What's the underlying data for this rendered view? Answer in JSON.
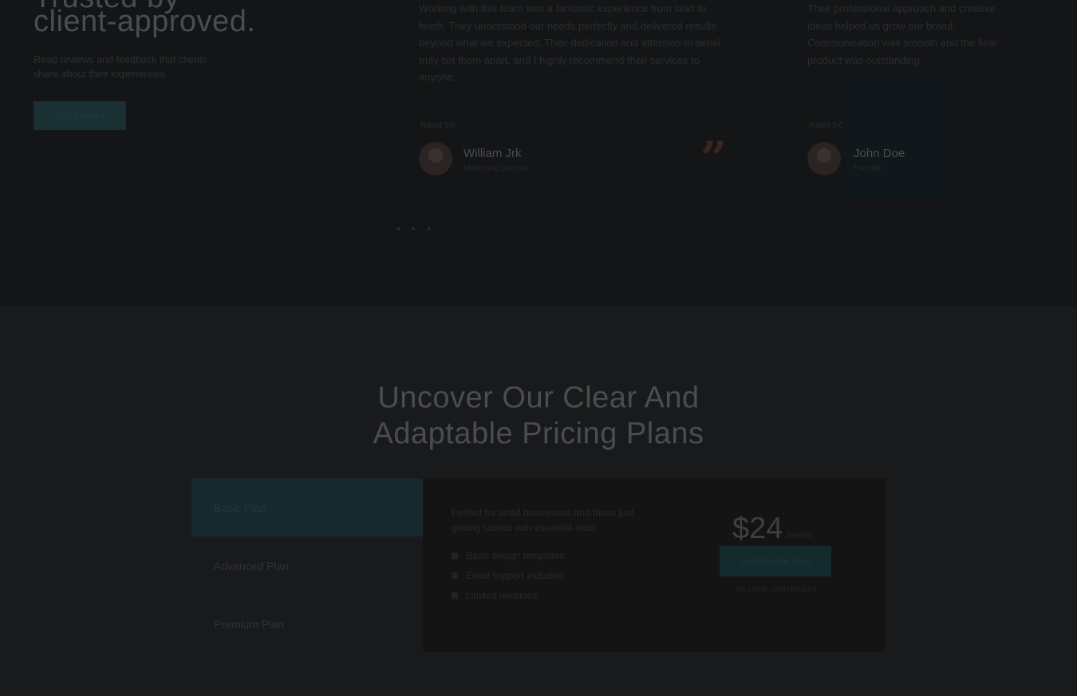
{
  "hero": {
    "title_line1": "Trusted by",
    "title_line2": "client-approved.",
    "description": "Read reviews and feedback that clients share about their experiences.",
    "cta_label": "Get Started"
  },
  "testimonials": [
    {
      "quote": "Working with this team was a fantastic experience from start to finish. They understood our needs perfectly and delivered results beyond what we expected. Their dedication and attention to detail truly set them apart, and I highly recommend their services to anyone.",
      "rated_label": "Rated 5.0",
      "name": "William Jrk",
      "role": "Marketing Director"
    },
    {
      "quote": "Their professional approach and creative ideas helped us grow our brand. Communication was smooth and the final product was outstanding.",
      "rated_label": "Rated 5.0",
      "name": "John Doe",
      "role": "Founder"
    }
  ],
  "quote_icon": "quote-icon",
  "pricing": {
    "title_line1": "Uncover Our Clear And",
    "title_line2": "Adaptable Pricing Plans",
    "tabs": [
      {
        "label": "Basic Plan"
      },
      {
        "label": "Advanced Plan"
      },
      {
        "label": "Premium Plan"
      }
    ],
    "panel": {
      "description": "Perfect for small businesses and those just getting started with essential tools.",
      "features": [
        "Basic design templates",
        "Email support included",
        "Limited revisions"
      ],
      "price": "$24",
      "price_period": "/month",
      "button_label": "Get Started Now",
      "note": "No credit card required"
    }
  },
  "colors": {
    "accent": "#1a3033",
    "quote": "#3a2420",
    "overlay_bg": "#141516"
  }
}
